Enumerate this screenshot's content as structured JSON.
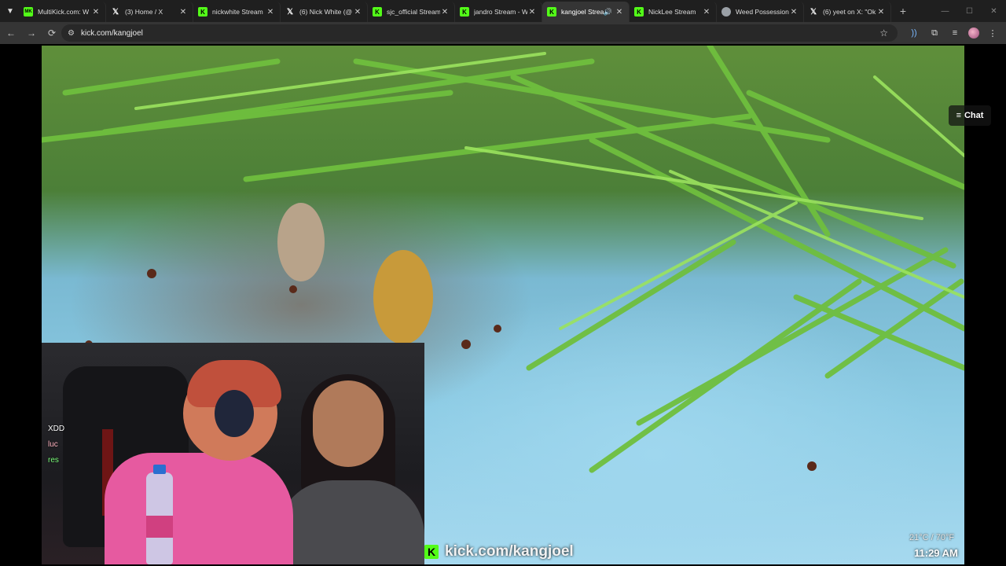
{
  "browser": {
    "tabs": [
      {
        "label": "MultiKick.com: W",
        "favicon": "multikick-icon",
        "active": false
      },
      {
        "label": "(3) Home / X",
        "favicon": "x-icon",
        "active": false
      },
      {
        "label": "nickwhite Stream",
        "favicon": "kick-icon",
        "active": false
      },
      {
        "label": "(6) Nick White (@",
        "favicon": "x-icon",
        "active": false
      },
      {
        "label": "sjc_official Stream",
        "favicon": "kick-icon",
        "active": false
      },
      {
        "label": "jandro Stream - W",
        "favicon": "kick-icon",
        "active": false
      },
      {
        "label": "kangjoel Strea",
        "favicon": "kick-icon",
        "active": true,
        "audible": true
      },
      {
        "label": "NickLee Stream",
        "favicon": "kick-icon",
        "active": false
      },
      {
        "label": "Weed Possession",
        "favicon": "globe-icon",
        "active": false
      },
      {
        "label": "(6) yeet on X: \"Ok",
        "favicon": "x-icon",
        "active": false
      }
    ],
    "url": "kick.com/kangjoel",
    "multikick_badge": "MK",
    "x_glyph": "𝕏",
    "kick_glyph": "K"
  },
  "player": {
    "chat_button_label": "Chat",
    "chat_overlay_lines": [
      "XDD",
      "luc",
      "res"
    ],
    "watermark_text": "kick.com/kangjoel",
    "weather": "21°C / 70°F",
    "clock": "11:29 AM"
  },
  "colors": {
    "kick_green": "#53fc18",
    "tab_bar": "#1f1f1f",
    "toolbar": "#353535"
  }
}
